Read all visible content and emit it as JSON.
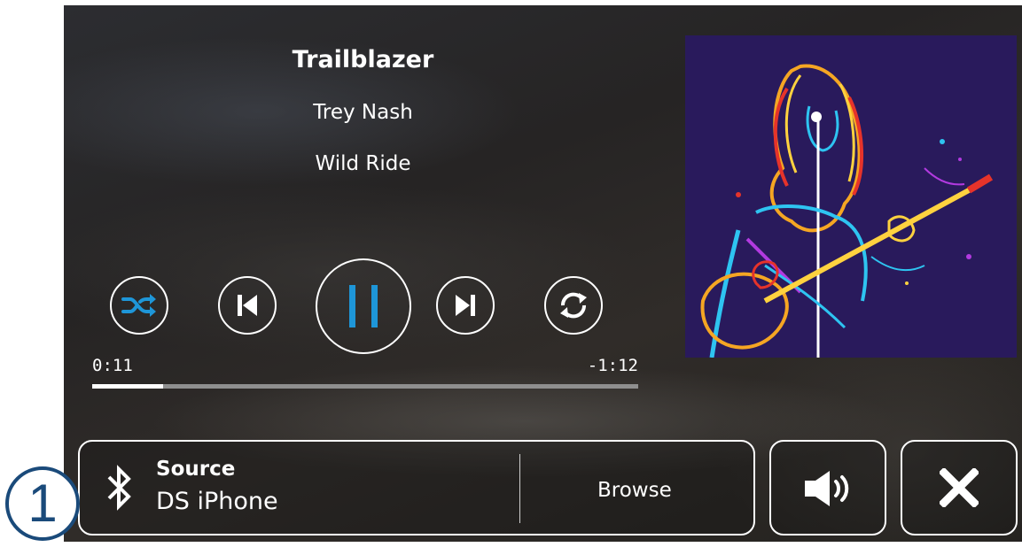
{
  "now_playing": {
    "title": "Trailblazer",
    "artist": "Trey Nash",
    "album": "Wild Ride"
  },
  "controls": {
    "shuffle_icon": "shuffle-icon",
    "previous_icon": "skip-previous-icon",
    "play_pause_icon": "pause-icon",
    "next_icon": "skip-next-icon",
    "repeat_icon": "repeat-icon",
    "accent_color": "#1e96d8"
  },
  "progress": {
    "elapsed": "0:11",
    "remaining": "-1:12",
    "fraction": 0.13
  },
  "album_art": {
    "description_icon": "album-art-guitarist"
  },
  "bottom_bar": {
    "source_label": "Source",
    "source_value": "DS iPhone",
    "source_icon": "bluetooth-icon",
    "browse_label": "Browse",
    "volume_icon": "volume-icon",
    "close_icon": "close-icon"
  },
  "callout": {
    "number": "1"
  }
}
